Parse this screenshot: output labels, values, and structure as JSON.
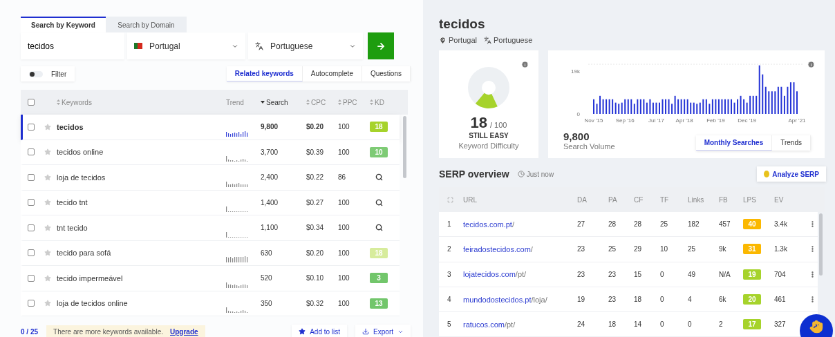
{
  "search_tabs": [
    {
      "label": "Search by Keyword",
      "selected": true
    },
    {
      "label": "Search by Domain",
      "selected": false
    }
  ],
  "search": {
    "value": "tecidos",
    "country": "Portugal",
    "language": "Portuguese"
  },
  "filter": {
    "label": "Filter",
    "on": false
  },
  "view_tabs": [
    {
      "label": "Related keywords",
      "selected": true
    },
    {
      "label": "Autocomplete",
      "selected": false
    },
    {
      "label": "Questions",
      "selected": false
    }
  ],
  "keyword_table": {
    "all_checked": false,
    "columns": [
      {
        "label": "Keywords",
        "sortable": true,
        "sorted": false
      },
      {
        "label": "Trend",
        "sortable": false,
        "sorted": false
      },
      {
        "label": "Search",
        "sortable": true,
        "sorted": true
      },
      {
        "label": "CPC",
        "sortable": true,
        "sorted": false
      },
      {
        "label": "PPC",
        "sortable": true,
        "sorted": false
      },
      {
        "label": "KD",
        "sortable": true,
        "sorted": false
      }
    ],
    "rows": [
      {
        "keyword": "tecidos",
        "selected": true,
        "checked": false,
        "starred": false,
        "search": "9,800",
        "cpc": "$0.20",
        "ppc": "100",
        "kd": {
          "kind": "badge",
          "value": "18",
          "color": "#a6d32b"
        }
      },
      {
        "keyword": "tecidos online",
        "selected": false,
        "checked": false,
        "starred": false,
        "search": "3,700",
        "cpc": "$0.39",
        "ppc": "100",
        "kd": {
          "kind": "badge",
          "value": "10",
          "color": "#7ecb75"
        }
      },
      {
        "keyword": "loja de tecidos",
        "selected": false,
        "checked": false,
        "starred": false,
        "search": "2,400",
        "cpc": "$0.22",
        "ppc": "86",
        "kd": {
          "kind": "lookup"
        }
      },
      {
        "keyword": "tecido tnt",
        "selected": false,
        "checked": false,
        "starred": false,
        "search": "1,400",
        "cpc": "$0.27",
        "ppc": "100",
        "kd": {
          "kind": "lookup"
        }
      },
      {
        "keyword": "tnt tecido",
        "selected": false,
        "checked": false,
        "starred": false,
        "search": "1,100",
        "cpc": "$0.34",
        "ppc": "100",
        "kd": {
          "kind": "lookup"
        }
      },
      {
        "keyword": "tecido para sofá",
        "selected": false,
        "checked": false,
        "starred": false,
        "search": "630",
        "cpc": "$0.20",
        "ppc": "100",
        "kd": {
          "kind": "badge",
          "value": "18",
          "color": "#d7ec9c"
        }
      },
      {
        "keyword": "tecido impermeável",
        "selected": false,
        "checked": false,
        "starred": false,
        "search": "520",
        "cpc": "$0.10",
        "ppc": "100",
        "kd": {
          "kind": "badge",
          "value": "3",
          "color": "#72c66b"
        }
      },
      {
        "keyword": "loja de tecidos online",
        "selected": false,
        "checked": false,
        "starred": false,
        "search": "350",
        "cpc": "$0.32",
        "ppc": "100",
        "kd": {
          "kind": "badge",
          "value": "13",
          "color": "#72c66b"
        }
      }
    ]
  },
  "footer": {
    "count": "0 / 25",
    "notice": "There are more keywords available.",
    "upgrade": "Upgrade",
    "add_to_list": "Add to list",
    "export": "Export"
  },
  "keyword": {
    "title": "tecidos",
    "country": "Portugal",
    "language": "Portuguese"
  },
  "difficulty": {
    "score": "18",
    "max": "/ 100",
    "verdict": "STILL EASY",
    "label": "Keyword Difficulty"
  },
  "volume": {
    "value": "9,800",
    "label": "Search Volume",
    "chart": {
      "y_labels": [
        "19k",
        "0"
      ],
      "x_labels": [
        "Nov '15",
        "Sep '16",
        "Jul '17",
        "Apr '18",
        "Feb '19",
        "Dec '19",
        "Apr '21"
      ]
    },
    "tabs": [
      {
        "label": "Monthly Searches",
        "selected": true
      },
      {
        "label": "Trends",
        "selected": false
      }
    ]
  },
  "serp": {
    "title": "SERP overview",
    "updated": "Just now",
    "analyze": "Analyze SERP",
    "columns": [
      "URL",
      "DA",
      "PA",
      "CF",
      "TF",
      "Links",
      "FB",
      "LPS",
      "EV"
    ],
    "rows": [
      {
        "rank": "1",
        "domain": "tecidos.com.pt",
        "path": "/",
        "da": "27",
        "pa": "28",
        "cf": "28",
        "tf": "25",
        "links": "182",
        "fb": "457",
        "lps": {
          "value": "40",
          "color": "#fbb800"
        },
        "ev": "3.4k"
      },
      {
        "rank": "2",
        "domain": "feiradostecidos.com",
        "path": "/",
        "da": "23",
        "pa": "25",
        "cf": "29",
        "tf": "10",
        "links": "25",
        "fb": "9k",
        "lps": {
          "value": "31",
          "color": "#fbb800"
        },
        "ev": "1.3k"
      },
      {
        "rank": "3",
        "domain": "lojatecidos.com",
        "path": "/pt/",
        "da": "23",
        "pa": "23",
        "cf": "15",
        "tf": "0",
        "links": "49",
        "fb": "N/A",
        "lps": {
          "value": "19",
          "color": "#a6d32b"
        },
        "ev": "704"
      },
      {
        "rank": "4",
        "domain": "mundodostecidos.pt",
        "path": "/loja/",
        "da": "19",
        "pa": "23",
        "cf": "18",
        "tf": "0",
        "links": "4",
        "fb": "6k",
        "lps": {
          "value": "20",
          "color": "#a6d32b"
        },
        "ev": "461"
      },
      {
        "rank": "5",
        "domain": "ratucos.com",
        "path": "/pt/",
        "da": "24",
        "pa": "18",
        "cf": "14",
        "tf": "0",
        "links": "0",
        "fb": "2",
        "lps": {
          "value": "17",
          "color": "#a6d32b"
        },
        "ev": "327"
      }
    ]
  }
}
